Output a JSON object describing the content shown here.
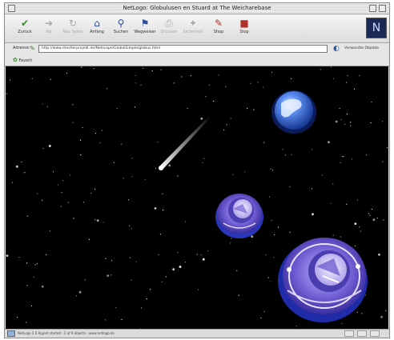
{
  "window": {
    "title": "NetLogo: Globulusen en Stuard at The Weicharebase"
  },
  "toolbar": {
    "buttons": [
      {
        "label": "Zurück",
        "icon": "back-arrow-icon",
        "disabled": false,
        "color": "#3a8a2a"
      },
      {
        "label": "Vor",
        "icon": "forward-arrow-icon",
        "disabled": true,
        "color": "#a8a8a8"
      },
      {
        "label": "Neu laden",
        "icon": "reload-icon",
        "disabled": true,
        "color": "#a8a8a8"
      },
      {
        "label": "Anfang",
        "icon": "home-icon",
        "disabled": false,
        "color": "#2a4a9a"
      },
      {
        "label": "Suchen",
        "icon": "search-icon",
        "disabled": false,
        "color": "#2a4a9a"
      },
      {
        "label": "Wegweiser",
        "icon": "guide-icon",
        "disabled": false,
        "color": "#2a4a9a"
      },
      {
        "label": "Drucken",
        "icon": "print-icon",
        "disabled": true,
        "color": "#a8a8a8"
      },
      {
        "label": "Sicherheit",
        "icon": "security-icon",
        "disabled": true,
        "color": "#a8a8a8"
      },
      {
        "label": "Shop",
        "icon": "shop-icon",
        "disabled": false,
        "color": "#b0302a"
      },
      {
        "label": "Stop",
        "icon": "stop-icon",
        "disabled": false,
        "color": "#b0302a"
      }
    ]
  },
  "location": {
    "label": "Adresse:",
    "url": "http://www.drestlerprojekt.de/Netscape/GlobalSimple/globus.html",
    "related_label": "Verwandte Objekte"
  },
  "favorites": {
    "label": "Favorit"
  },
  "status": {
    "text": "NetLogo 2.0 Applet started · 2 of 6 objects · www.netlogo.de"
  },
  "colors": {
    "space": "#000000",
    "planet_blue": "#3b74d6",
    "satellite_purple": "#7b63d4"
  }
}
